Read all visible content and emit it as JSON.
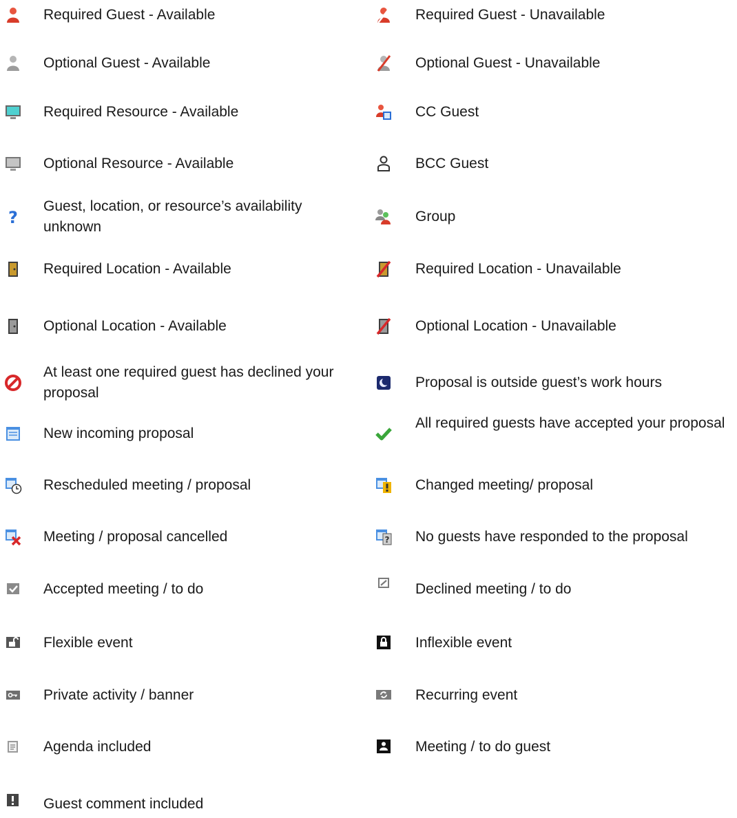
{
  "legend": {
    "left": [
      {
        "name": "required-guest-available",
        "icon": "person-red-icon",
        "label": "Required Guest - Available",
        "color": "#d83c2a"
      },
      {
        "name": "optional-guest-available",
        "icon": "person-gray-icon",
        "label": "Optional Guest - Available",
        "color": "#9c9c9c"
      },
      {
        "name": "required-resource-available",
        "icon": "monitor-teal-icon",
        "label": "Required Resource - Available",
        "color": "#3ec8c8"
      },
      {
        "name": "optional-resource-available",
        "icon": "monitor-gray-icon",
        "label": "Optional Resource - Available",
        "color": "#a8a8a8"
      },
      {
        "name": "availability-unknown",
        "icon": "question-mark-icon",
        "label": "Guest, location, or resource’s availability unknown",
        "color": "#2b6fd6"
      },
      {
        "name": "required-location-available",
        "icon": "door-gold-icon",
        "label": "Required Location - Available",
        "color": "#c99a2e"
      },
      {
        "name": "optional-location-available",
        "icon": "door-gray-icon",
        "label": "Optional Location - Available",
        "color": "#8a8a8a"
      },
      {
        "name": "required-guest-declined",
        "icon": "no-entry-icon",
        "label": "At least one required guest has declined your proposal",
        "color": "#d8282a"
      },
      {
        "name": "new-incoming-proposal",
        "icon": "calendar-note-icon",
        "label": "New incoming proposal",
        "color": "#4a90e2"
      },
      {
        "name": "rescheduled-meeting",
        "icon": "calendar-clock-icon",
        "label": "Rescheduled meeting / proposal",
        "color": "#4a90e2"
      },
      {
        "name": "meeting-cancelled",
        "icon": "calendar-x-icon",
        "label": "Meeting / proposal cancelled",
        "color": "#d8282a"
      },
      {
        "name": "accepted-meeting",
        "icon": "checkbox-checked-icon",
        "label": "Accepted meeting / to do",
        "color": "#7a7a7a"
      },
      {
        "name": "flexible-event",
        "icon": "unlocked-icon",
        "label": "Flexible event",
        "color": "#555555"
      },
      {
        "name": "private-activity",
        "icon": "key-icon",
        "label": "Private activity / banner",
        "color": "#6e6e6e"
      },
      {
        "name": "agenda-included",
        "icon": "document-icon",
        "label": "Agenda included",
        "color": "#8a8a8a"
      },
      {
        "name": "guest-comment-included",
        "icon": "exclamation-box-icon",
        "label": "Guest comment included",
        "color": "#444444"
      }
    ],
    "right": [
      {
        "name": "required-guest-unavailable",
        "icon": "person-red-slashed-icon",
        "label": "Required Guest - Unavailable",
        "color": "#d83c2a"
      },
      {
        "name": "optional-guest-unavailable",
        "icon": "person-gray-slashed-icon",
        "label": "Optional Guest - Unavailable",
        "color": "#9c9c9c"
      },
      {
        "name": "cc-guest",
        "icon": "person-card-icon",
        "label": "CC Guest",
        "color": "#2b6fd6"
      },
      {
        "name": "bcc-guest",
        "icon": "person-outline-icon",
        "label": "BCC Guest",
        "color": "#333333"
      },
      {
        "name": "group",
        "icon": "group-icon",
        "label": "Group",
        "color": "#4aa84a"
      },
      {
        "name": "required-location-unavailable",
        "icon": "door-gold-slashed-icon",
        "label": "Required Location - Unavailable",
        "color": "#c99a2e"
      },
      {
        "name": "optional-location-unavailable",
        "icon": "door-gray-slashed-icon",
        "label": "Optional Location - Unavailable",
        "color": "#8a8a8a"
      },
      {
        "name": "outside-work-hours",
        "icon": "moon-icon",
        "label": "Proposal is outside guest’s work hours",
        "color": "#1c2a6e"
      },
      {
        "name": "all-accepted",
        "icon": "check-mark-icon",
        "label": "All required guests have accepted your proposal",
        "color": "#3aa63a"
      },
      {
        "name": "changed-meeting",
        "icon": "calendar-exclamation-icon",
        "label": "Changed meeting/ proposal",
        "color": "#f0b400"
      },
      {
        "name": "no-responses",
        "icon": "calendar-question-icon",
        "label": "No guests have responded to the proposal",
        "color": "#4a90e2"
      },
      {
        "name": "declined-meeting",
        "icon": "checkbox-declined-icon",
        "label": "Declined meeting / to do",
        "color": "#7a7a7a"
      },
      {
        "name": "inflexible-event",
        "icon": "locked-icon",
        "label": "Inflexible event",
        "color": "#111111"
      },
      {
        "name": "recurring-event",
        "icon": "recurring-icon",
        "label": "Recurring event",
        "color": "#7a7a7a"
      },
      {
        "name": "meeting-guest",
        "icon": "person-box-icon",
        "label": "Meeting / to do guest",
        "color": "#111111"
      }
    ]
  }
}
